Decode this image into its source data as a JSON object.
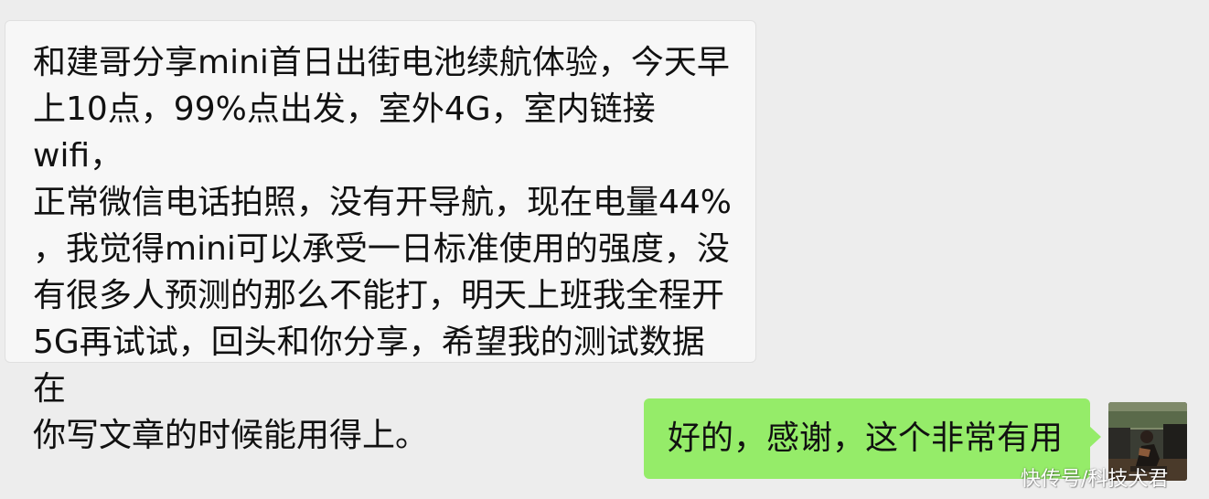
{
  "chat": {
    "incoming_message": {
      "text": "和建哥分享mini首日出街电池续航体验，今天早\n上10点，99%点出发，室外4G，室内链接wifi，\n正常微信电话拍照，没有开导航，现在电量44%\n，我觉得mini可以承受一日标准使用的强度，没\n有很多人预测的那么不能打，明天上班我全程开\n5G再试试，回头和你分享，希望我的测试数据在\n你写文章的时候能用得上。"
    },
    "outgoing_message": {
      "text": "好的，感谢，这个非常有用"
    },
    "avatar": {
      "icon": "user-avatar-photo"
    }
  },
  "watermark": {
    "text": "快传号/科技犬君"
  },
  "colors": {
    "background": "#ededed",
    "incoming_bubble": "#f7f7f7",
    "outgoing_bubble": "#95ec69"
  }
}
